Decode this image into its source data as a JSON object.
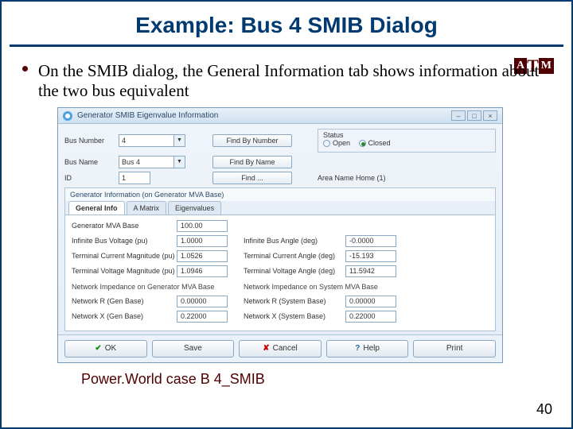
{
  "title": "Example: Bus 4 SMIB Dialog",
  "logo": {
    "aTm": "A|M",
    "t": "T"
  },
  "bullet": "On the SMIB dialog, the General Information tab shows information about the two bus equivalent",
  "dlg": {
    "title": "Generator SMIB Eigenvalue Information",
    "winbtns": [
      "–",
      "□",
      "×"
    ],
    "busNumLabel": "Bus Number",
    "busNumVal": "4",
    "findByNumber": "Find By Number",
    "busNameLabel": "Bus Name",
    "busNameVal": "Bus 4",
    "findByName": "Find By Name",
    "idLabel": "ID",
    "idVal": "1",
    "findBtn": "Find ...",
    "statusLabel": "Status",
    "statusOpen": "Open",
    "statusClosed": "Closed",
    "areaNameLabel": "Area Name",
    "areaNameVal": "Home (1)",
    "groupTitle": "Generator Information (on Generator MVA Base)",
    "tabs": {
      "t1": "General Info",
      "t2": "A Matrix",
      "t3": "Eigenvalues"
    },
    "mvaBaseLabel": "Generator MVA Base",
    "mvaBaseVal": "100.00",
    "infBusVLabel": "Infinite Bus Voltage (pu)",
    "infBusVVal": "1.0000",
    "infBusALabel": "Infinite Bus Angle (deg)",
    "infBusAVal": "-0.0000",
    "termIMLabel": "Terminal Current Magnitude (pu)",
    "termIMVal": "1.0526",
    "termIALabel": "Terminal Current Angle (deg)",
    "termIAVal": "-15.193",
    "termVMLabel": "Terminal Voltage Magnitude (pu)",
    "termVMVal": "1.0946",
    "termVALabel": "Terminal Voltage Angle (deg)",
    "termVAVal": "11.5942",
    "netGenHdr": "Network Impedance on Generator MVA Base",
    "netSysHdr": "Network Impedance on System MVA Base",
    "netRGLabel": "Network R (Gen Base)",
    "netRGVal": "0.00000",
    "netRSLabel": "Network R (System Base)",
    "netRSVal": "0.00000",
    "netXGLabel": "Network X (Gen Base)",
    "netXGVal": "0.22000",
    "netXSLabel": "Network X (System Base)",
    "netXSVal": "0.22000",
    "ok": "OK",
    "save": "Save",
    "cancel": "Cancel",
    "help": "Help",
    "print": "Print"
  },
  "caption": "Power.World case B 4_SMIB",
  "pagenum": "40"
}
